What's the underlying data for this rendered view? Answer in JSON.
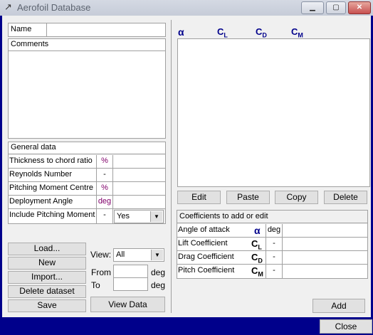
{
  "window": {
    "title": "Aerofoil Database"
  },
  "left": {
    "name_label": "Name",
    "comments_label": "Comments",
    "general_title": "General data",
    "rows": [
      {
        "label": "Thickness to chord ratio",
        "unit": "%"
      },
      {
        "label": "Reynolds Number",
        "unit": "-"
      },
      {
        "label": "Pitching Moment Centre",
        "unit": "%"
      },
      {
        "label": "Deployment Angle",
        "unit": "deg"
      },
      {
        "label": "Include Pitching Moment",
        "unit": "-",
        "value": "Yes"
      }
    ],
    "buttons": {
      "load": "Load...",
      "new": "New",
      "import": "Import...",
      "delete": "Delete dataset",
      "save": "Save"
    },
    "view_label": "View:",
    "view_value": "All",
    "from_label": "From",
    "to_label": "To",
    "deg": "deg",
    "view_data": "View Data"
  },
  "right": {
    "headers": {
      "alpha": "α",
      "cl": "C",
      "cl_sub": "L",
      "cd": "C",
      "cd_sub": "D",
      "cm": "C",
      "cm_sub": "M"
    },
    "buttons": {
      "edit": "Edit",
      "paste": "Paste",
      "copy": "Copy",
      "delete": "Delete"
    },
    "coeff_title": "Coefficients to add or edit",
    "coeff_rows": [
      {
        "label": "Angle of attack",
        "sym": "α",
        "sub": "",
        "unit": "deg"
      },
      {
        "label": "Lift Coefficient",
        "sym": "C",
        "sub": "L",
        "unit": "-"
      },
      {
        "label": "Drag Coefficient",
        "sym": "C",
        "sub": "D",
        "unit": "-"
      },
      {
        "label": "Pitch Coefficient",
        "sym": "C",
        "sub": "M",
        "unit": "-"
      }
    ],
    "add": "Add"
  },
  "close": "Close"
}
